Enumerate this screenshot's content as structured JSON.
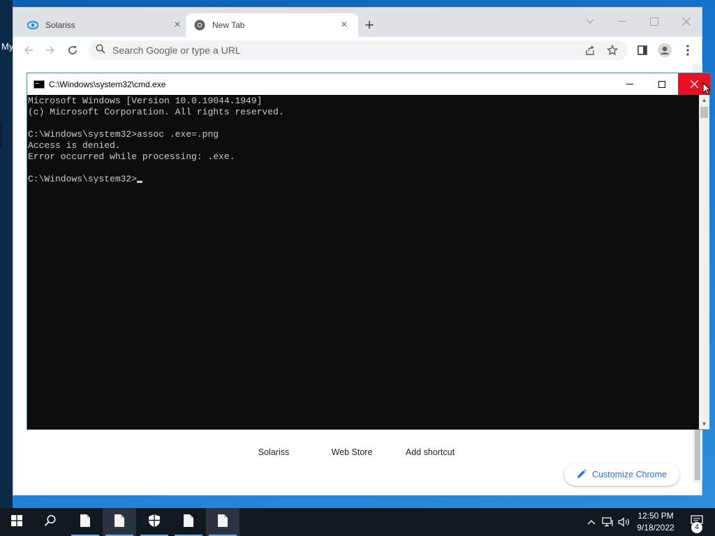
{
  "desktop": {
    "label": "My"
  },
  "chrome": {
    "tabs": [
      {
        "title": "Solariss",
        "icon": "solariss-logo-icon",
        "active": false
      },
      {
        "title": "New Tab",
        "icon": "chrome-logo-icon",
        "active": true
      }
    ],
    "omnibox": {
      "placeholder": "Search Google or type a URL",
      "value": ""
    },
    "shortcuts": [
      "Solariss",
      "Web Store",
      "Add shortcut"
    ],
    "customize_label": "Customize Chrome",
    "colors": {
      "tabstrip": "#dee1e6",
      "accent": "#1a73e8"
    }
  },
  "cmd": {
    "title": "C:\\Windows\\system32\\cmd.exe",
    "lines": [
      "Microsoft Windows [Version 10.0.19044.1949]",
      "(c) Microsoft Corporation. All rights reserved.",
      "",
      "C:\\Windows\\system32>assoc .exe=.png",
      "Access is denied.",
      "Error occurred while processing: .exe.",
      "",
      "C:\\Windows\\system32>"
    ],
    "colors": {
      "background": "#0c0c0c",
      "text": "#cccccc",
      "close_hover": "#e81123"
    }
  },
  "taskbar": {
    "time": "12:50 PM",
    "date": "9/18/2022",
    "notification_count": "4"
  }
}
